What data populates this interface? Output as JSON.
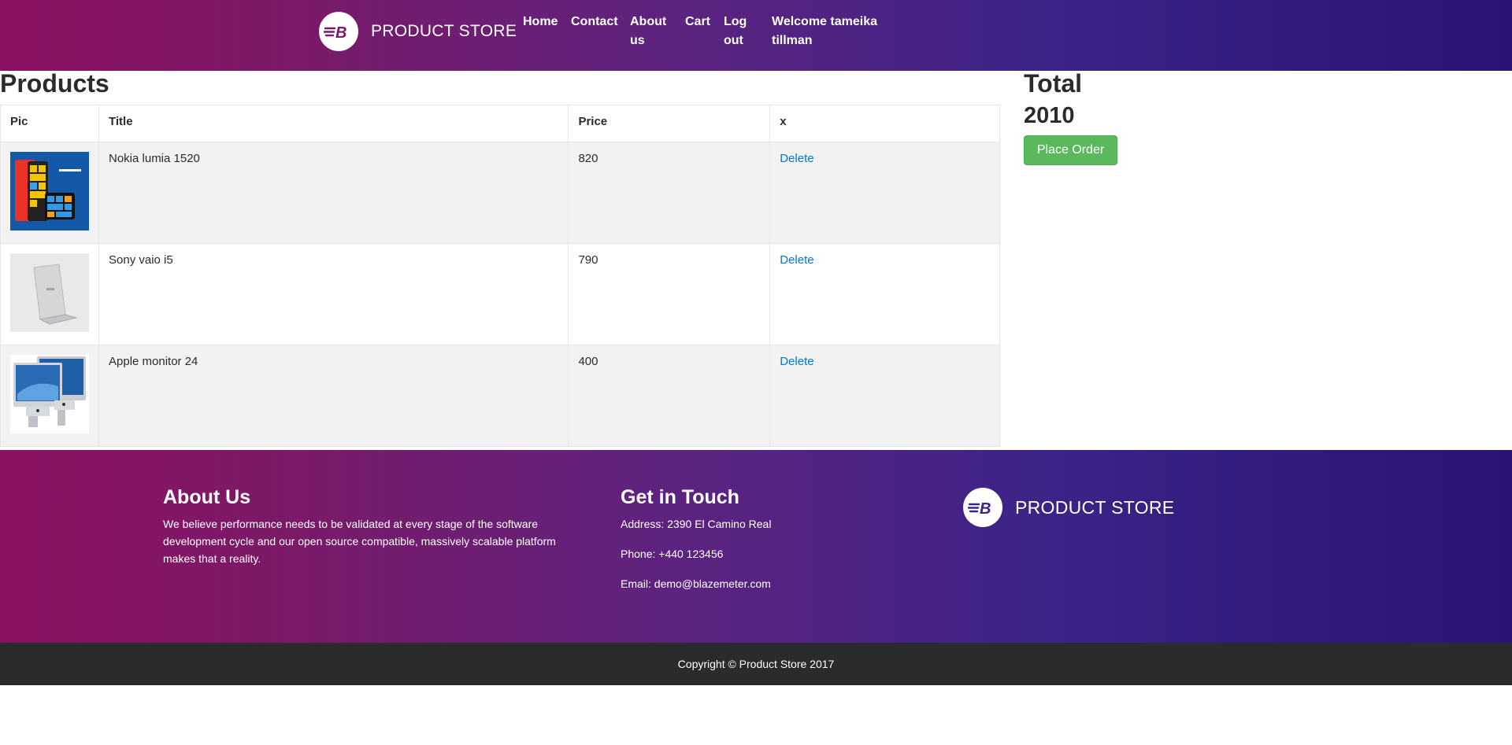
{
  "navbar": {
    "brand": "PRODUCT STORE",
    "logo_icon": "blazemeter-logo-icon",
    "items": [
      {
        "label": "Home"
      },
      {
        "label": "Contact"
      },
      {
        "label": "About",
        "label2": "us"
      },
      {
        "label": "Cart"
      },
      {
        "label": "Log",
        "label2": "out"
      }
    ],
    "welcome_line1": "Welcome tameika",
    "welcome_line2": "tillman"
  },
  "products": {
    "heading": "Products",
    "columns": [
      "Pic",
      "Title",
      "Price",
      "x"
    ],
    "rows": [
      {
        "title": "Nokia lumia 1520",
        "price": "820",
        "action": "Delete",
        "pic": "nokia-lumia-phone-image"
      },
      {
        "title": "Sony vaio i5",
        "price": "790",
        "action": "Delete",
        "pic": "sony-vaio-laptop-image"
      },
      {
        "title": "Apple monitor 24",
        "price": "400",
        "action": "Delete",
        "pic": "apple-monitor-image"
      }
    ]
  },
  "total": {
    "label": "Total",
    "value": "2010",
    "button": "Place Order"
  },
  "footer": {
    "about_heading": "About Us",
    "about_text_1": "We believe performance needs to be validated at every stage of the software",
    "about_text_2": "development cycle and our open source compatible, massively scalable platform",
    "about_text_3": "makes that a reality.",
    "contact_heading": "Get in Touch",
    "address": "Address: 2390 El Camino Real",
    "phone": "Phone: +440 123456",
    "email": "Email: demo@blazemeter.com",
    "brand": "PRODUCT STORE",
    "copyright": "Copyright © Product Store 2017"
  },
  "colors": {
    "gradient_left": "#8b1162",
    "gradient_right": "#2a1374",
    "link": "#0275d8",
    "button": "#5cb85c",
    "copyright_bg": "#292b2c"
  }
}
